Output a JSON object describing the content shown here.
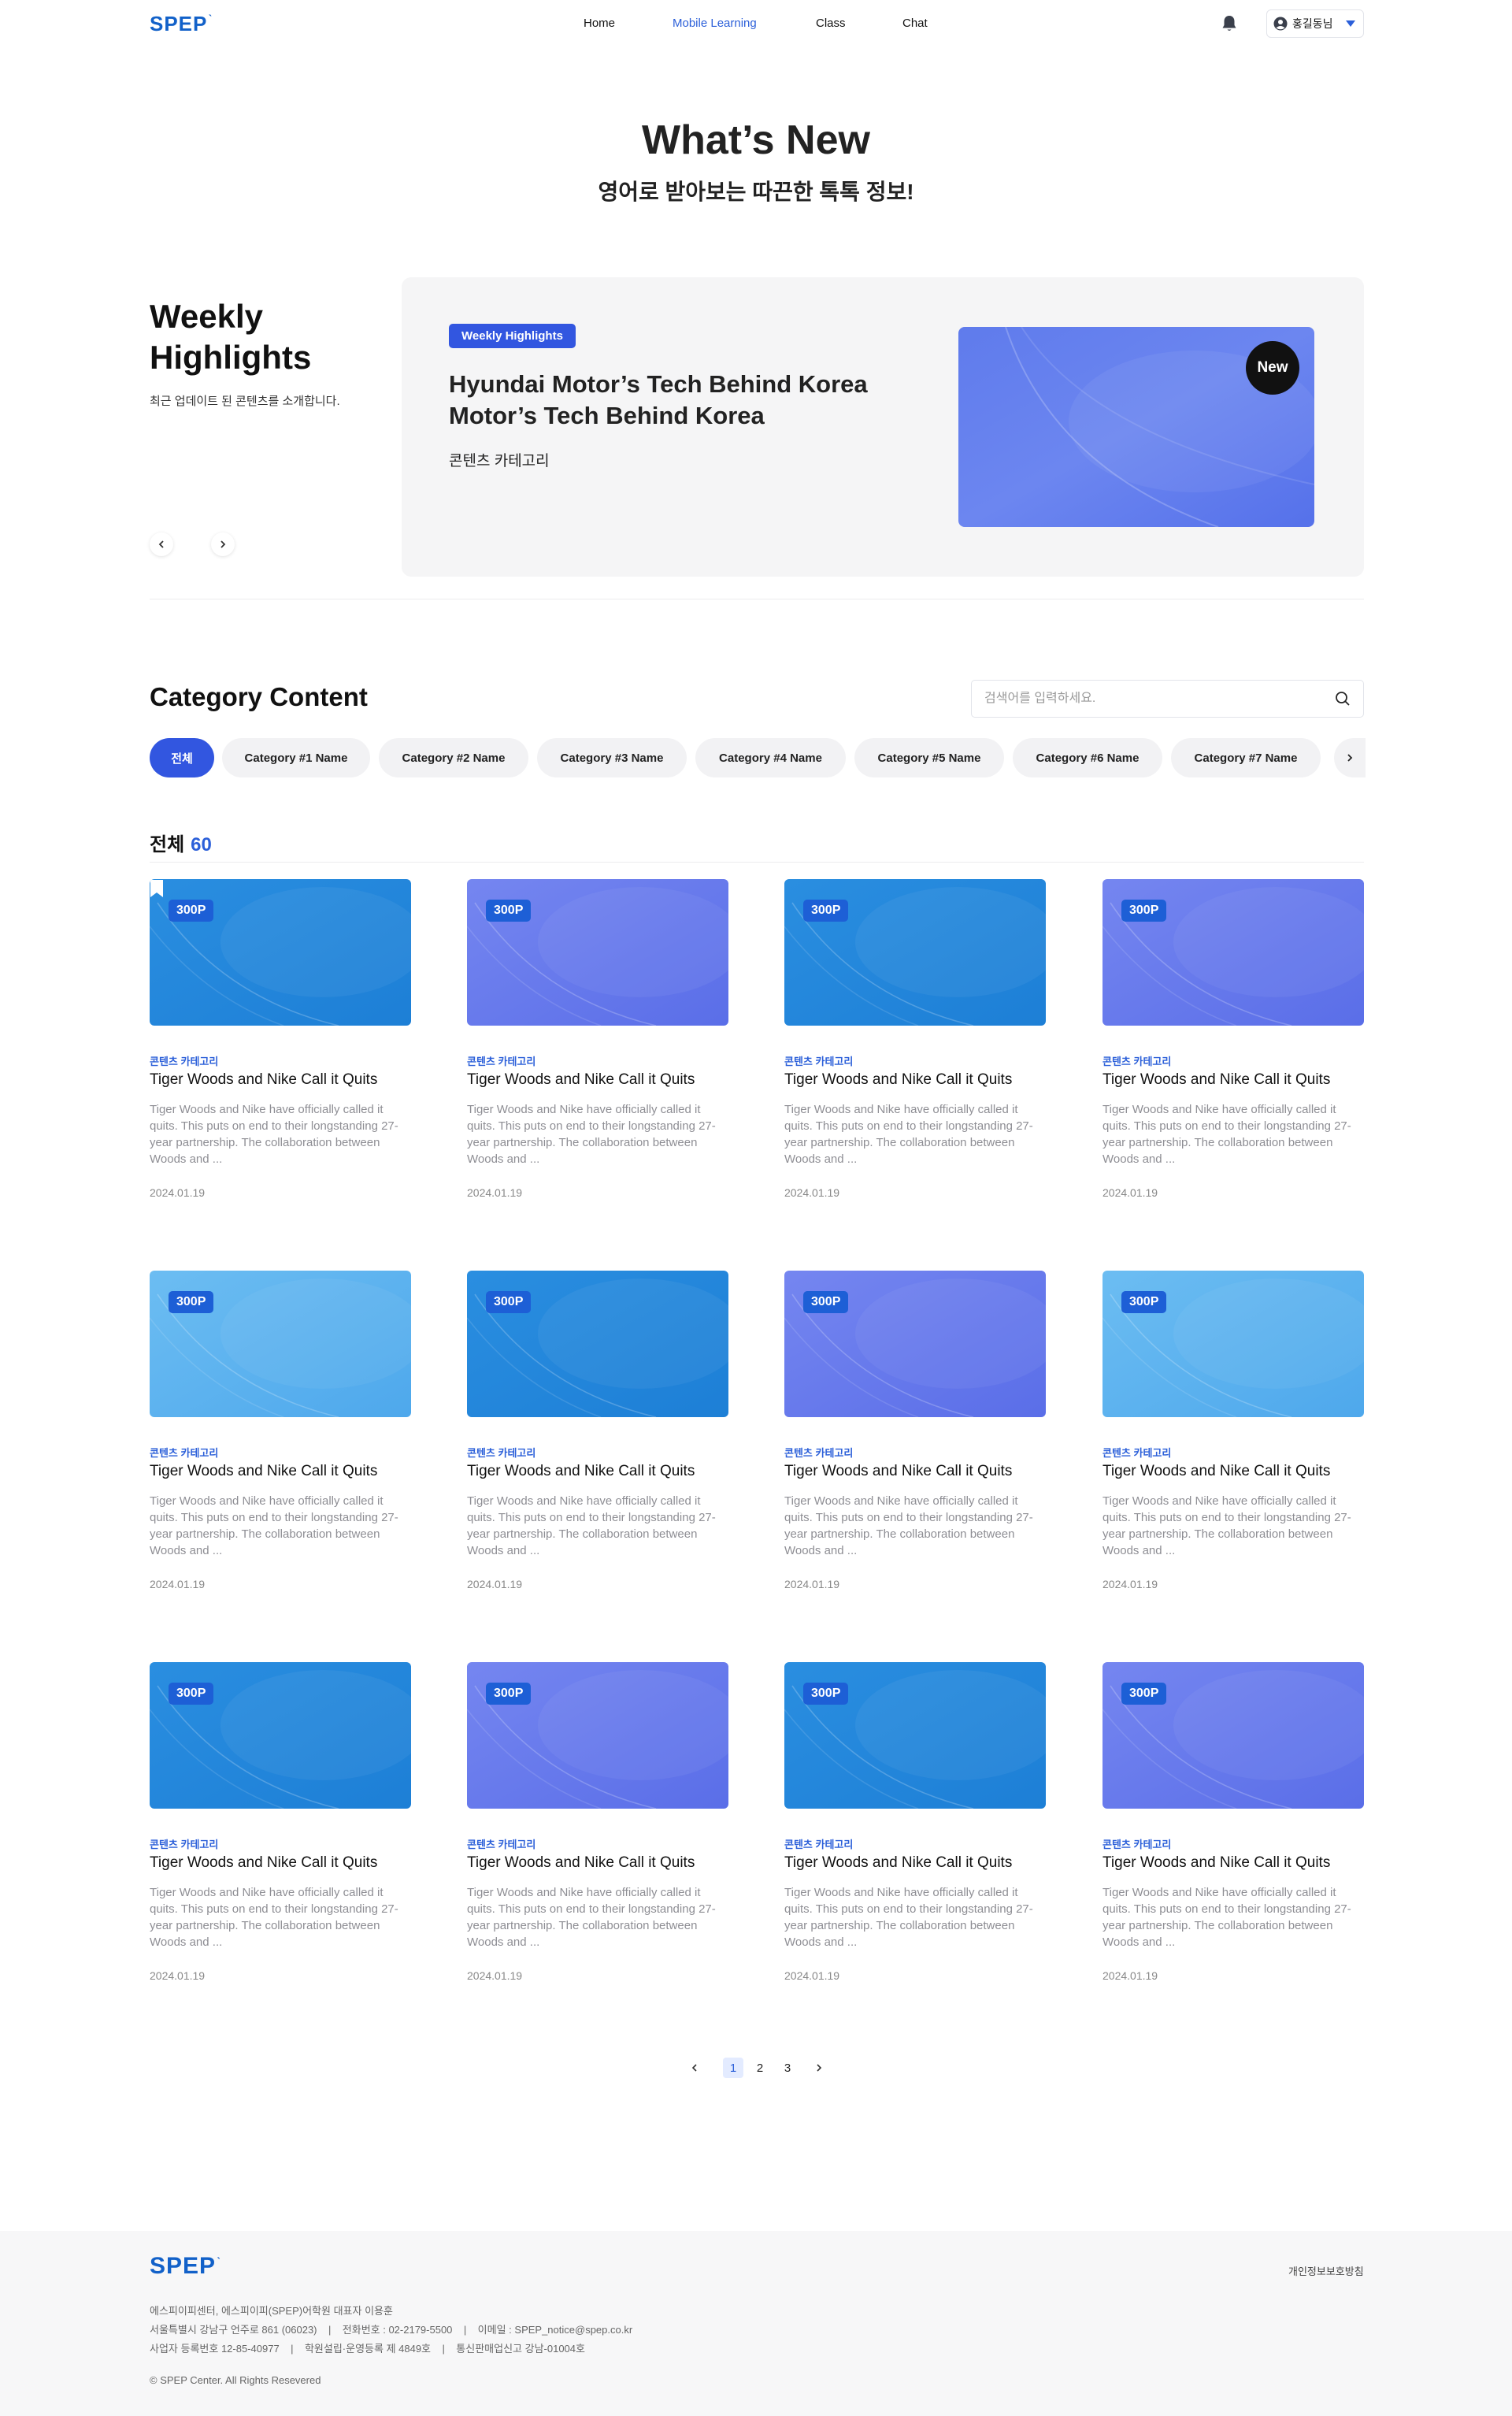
{
  "header": {
    "logo": "SPEP",
    "nav": [
      {
        "label": "Home",
        "active": false
      },
      {
        "label": "Mobile Learning",
        "active": true
      },
      {
        "label": "Class",
        "active": false
      },
      {
        "label": "Chat",
        "active": false
      }
    ],
    "user_name": "홍길동님",
    "icons": {
      "bell": "bell-icon",
      "user": "user-icon",
      "caret": "caret-down-icon"
    }
  },
  "hero": {
    "title": "What’s New",
    "subtitle": "영어로 받아보는 따끈한 톡톡 정보!"
  },
  "weekly": {
    "title": "Weekly Highlights",
    "description": "최근 업데이트 된 콘텐츠를 소개합니다.",
    "prev_icon": "chevron-left-icon",
    "next_icon": "chevron-right-icon",
    "badge": "Weekly Highlights",
    "headline": "Hyundai Motor’s Tech Behind Korea Motor’s Tech Behind Korea",
    "category": "콘텐츠 카테고리",
    "new_badge": "New"
  },
  "category_content": {
    "title": "Category Content",
    "search_placeholder": "검색어를 입력하세요.",
    "chips": [
      {
        "label": "전체",
        "active": true
      },
      {
        "label": "Category #1 Name",
        "active": false
      },
      {
        "label": "Category #2 Name",
        "active": false
      },
      {
        "label": "Category #3 Name",
        "active": false
      },
      {
        "label": "Category #4 Name",
        "active": false
      },
      {
        "label": "Category #5 Name",
        "active": false
      },
      {
        "label": "Category #6 Name",
        "active": false
      },
      {
        "label": "Category #7 Name",
        "active": false
      }
    ],
    "count_label": "전체",
    "count": "60"
  },
  "cards": [
    {
      "points": "300P",
      "category": "콘텐츠 카테고리",
      "title": "Tiger Woods and Nike Call it Quits",
      "description": "Tiger Woods and Nike have officially called it quits. This puts on end to their longstanding 27-year partnership. The collaboration between Woods and ...",
      "date": "2024.01.19",
      "theme": "blue",
      "bookmarked": true
    },
    {
      "points": "300P",
      "category": "콘텐츠 카테고리",
      "title": "Tiger Woods and Nike Call it Quits",
      "description": "Tiger Woods and Nike have officially called it quits. This puts on end to their longstanding 27-year partnership. The collaboration between Woods and ...",
      "date": "2024.01.19",
      "theme": "indigo",
      "bookmarked": false
    },
    {
      "points": "300P",
      "category": "콘텐츠 카테고리",
      "title": "Tiger Woods and Nike Call it Quits",
      "description": "Tiger Woods and Nike have officially called it quits. This puts on end to their longstanding 27-year partnership. The collaboration between Woods and ...",
      "date": "2024.01.19",
      "theme": "blue",
      "bookmarked": false
    },
    {
      "points": "300P",
      "category": "콘텐츠 카테고리",
      "title": "Tiger Woods and Nike Call it Quits",
      "description": "Tiger Woods and Nike have officially called it quits. This puts on end to their longstanding 27-year partnership. The collaboration between Woods and ...",
      "date": "2024.01.19",
      "theme": "indigo",
      "bookmarked": false
    },
    {
      "points": "300P",
      "category": "콘텐츠 카테고리",
      "title": "Tiger Woods and Nike Call it Quits",
      "description": "Tiger Woods and Nike have officially called it quits. This puts on end to their longstanding 27-year partnership. The collaboration between Woods and ...",
      "date": "2024.01.19",
      "theme": "sky",
      "bookmarked": false
    },
    {
      "points": "300P",
      "category": "콘텐츠 카테고리",
      "title": "Tiger Woods and Nike Call it Quits",
      "description": "Tiger Woods and Nike have officially called it quits. This puts on end to their longstanding 27-year partnership. The collaboration between Woods and ...",
      "date": "2024.01.19",
      "theme": "blue",
      "bookmarked": false
    },
    {
      "points": "300P",
      "category": "콘텐츠 카테고리",
      "title": "Tiger Woods and Nike Call it Quits",
      "description": "Tiger Woods and Nike have officially called it quits. This puts on end to their longstanding 27-year partnership. The collaboration between Woods and ...",
      "date": "2024.01.19",
      "theme": "indigo",
      "bookmarked": false
    },
    {
      "points": "300P",
      "category": "콘텐츠 카테고리",
      "title": "Tiger Woods and Nike Call it Quits",
      "description": "Tiger Woods and Nike have officially called it quits. This puts on end to their longstanding 27-year partnership. The collaboration between Woods and ...",
      "date": "2024.01.19",
      "theme": "sky",
      "bookmarked": false
    },
    {
      "points": "300P",
      "category": "콘텐츠 카테고리",
      "title": "Tiger Woods and Nike Call it Quits",
      "description": "Tiger Woods and Nike have officially called it quits. This puts on end to their longstanding 27-year partnership. The collaboration between Woods and ...",
      "date": "2024.01.19",
      "theme": "blue",
      "bookmarked": false
    },
    {
      "points": "300P",
      "category": "콘텐츠 카테고리",
      "title": "Tiger Woods and Nike Call it Quits",
      "description": "Tiger Woods and Nike have officially called it quits. This puts on end to their longstanding 27-year partnership. The collaboration between Woods and ...",
      "date": "2024.01.19",
      "theme": "indigo",
      "bookmarked": false
    },
    {
      "points": "300P",
      "category": "콘텐츠 카테고리",
      "title": "Tiger Woods and Nike Call it Quits",
      "description": "Tiger Woods and Nike have officially called it quits. This puts on end to their longstanding 27-year partnership. The collaboration between Woods and ...",
      "date": "2024.01.19",
      "theme": "blue",
      "bookmarked": false
    },
    {
      "points": "300P",
      "category": "콘텐츠 카테고리",
      "title": "Tiger Woods and Nike Call it Quits",
      "description": "Tiger Woods and Nike have officially called it quits. This puts on end to their longstanding 27-year partnership. The collaboration between Woods and ...",
      "date": "2024.01.19",
      "theme": "indigo",
      "bookmarked": false
    }
  ],
  "themes": {
    "blue": [
      "#2a8ee0",
      "#1d7fd6"
    ],
    "indigo": [
      "#7586f0",
      "#5a6ee8"
    ],
    "sky": [
      "#6cbdf2",
      "#4ea8ec"
    ]
  },
  "pagination": {
    "pages": [
      "1",
      "2",
      "3"
    ],
    "current": "1",
    "prev_icon": "chevron-left-icon",
    "next_icon": "chevron-right-icon"
  },
  "footer": {
    "logo": "SPEP",
    "privacy_link": "개인정보보호방침",
    "line1": "에스피이피센터, 에스피이피(SPEP)어학원 대표자 이용훈",
    "line2": "서울특별시 강남구 언주로 861 (06023)    |    전화번호 : 02-2179-5500    |    이메일 : SPEP_notice@spep.co.kr",
    "line3": "사업자 등록번호 12-85-40977    |    학원설립·운영등록 제 4849호    |    통신판매업신고 강남-01004호",
    "copyright": "© SPEP Center. All Rights Resevered"
  },
  "colors": {
    "accent": "#3256e0",
    "link": "#2b5fd9",
    "logo": "#1261c9"
  }
}
